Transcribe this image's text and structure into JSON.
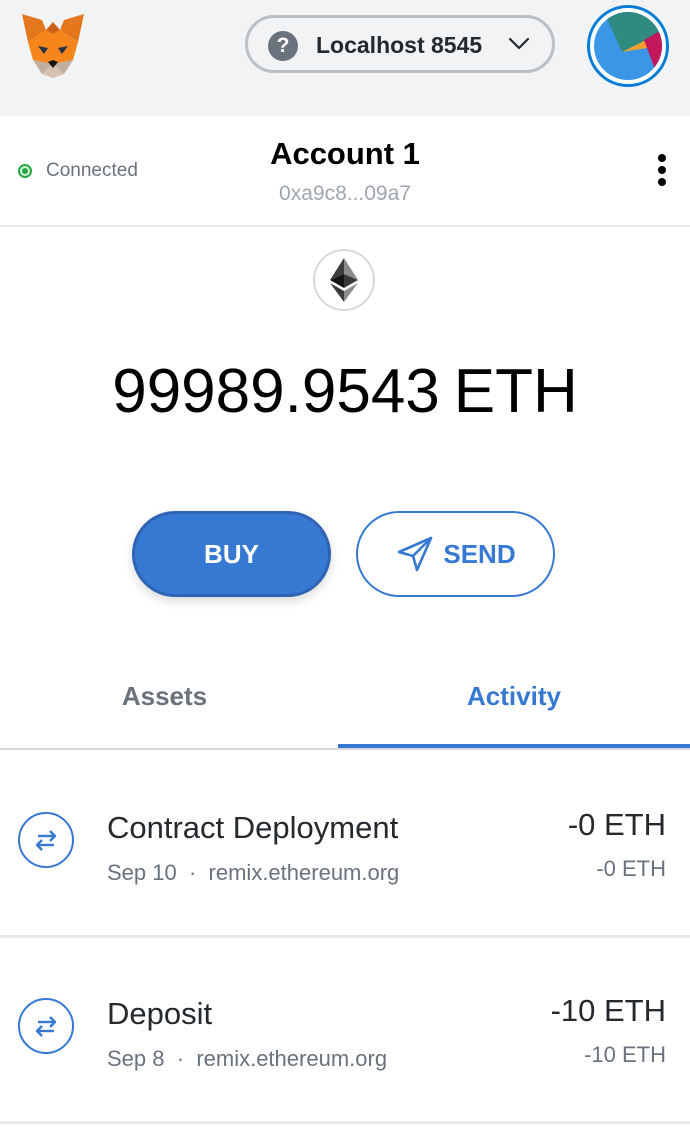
{
  "header": {
    "network": {
      "name": "Localhost 8545",
      "status_icon": "question-icon"
    }
  },
  "account": {
    "connection": {
      "label": "Connected",
      "color": "#28a745"
    },
    "name": "Account 1",
    "address": "0xa9c8...09a7"
  },
  "balance": {
    "amount": "99989.9543",
    "unit": "ETH"
  },
  "actions": {
    "buy_label": "BUY",
    "send_label": "SEND"
  },
  "tabs": [
    {
      "label": "Assets",
      "active": false
    },
    {
      "label": "Activity",
      "active": true
    }
  ],
  "activity": [
    {
      "title": "Contract Deployment",
      "date": "Sep 10",
      "origin": "remix.ethereum.org",
      "amount": "-0 ETH",
      "fiat": "-0 ETH"
    },
    {
      "title": "Deposit",
      "date": "Sep 8",
      "origin": "remix.ethereum.org",
      "amount": "-10 ETH",
      "fiat": "-10 ETH"
    }
  ],
  "colors": {
    "primary": "#3679d2",
    "header_bg": "#f2f3f4"
  }
}
